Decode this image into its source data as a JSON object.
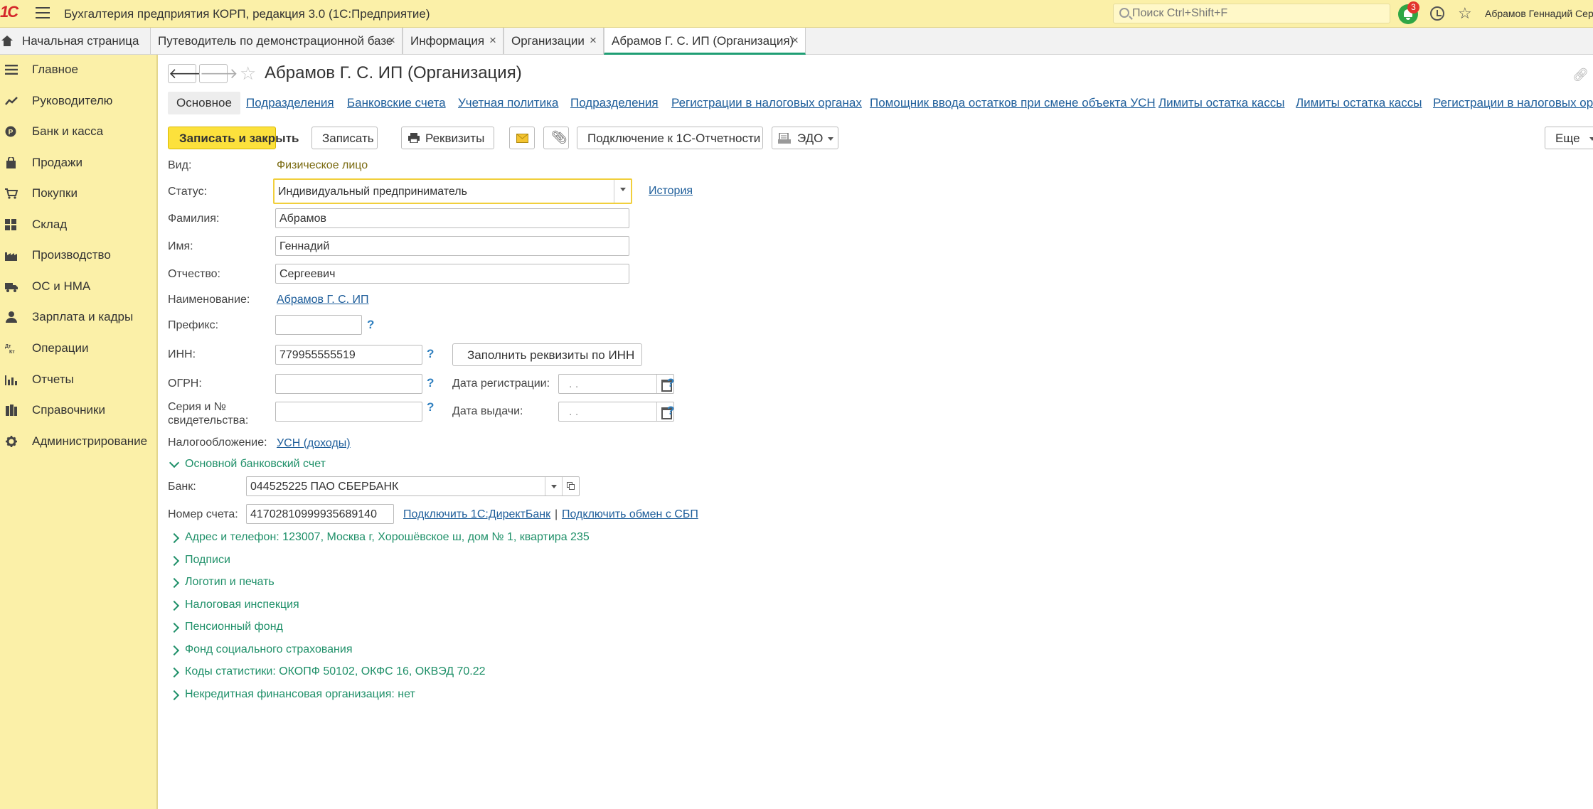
{
  "app": {
    "logo": "1С",
    "title": "Бухгалтерия предприятия КОРП, редакция 3.0  (1С:Предприятие)",
    "search_placeholder": "Поиск Ctrl+Shift+F",
    "notifications_count": "3",
    "user": "Абрамов Геннадий Серге"
  },
  "tabs": {
    "home": "Начальная страница",
    "items": [
      {
        "label": "Путеводитель по демонстрационной базе",
        "close": "×"
      },
      {
        "label": "Информация",
        "close": "×"
      },
      {
        "label": "Организации",
        "close": "×"
      },
      {
        "label": "Абрамов Г. С. ИП (Организация)",
        "close": "×"
      }
    ]
  },
  "sidebar": {
    "items": [
      {
        "label": "Главное",
        "icon": "menu-icon"
      },
      {
        "label": "Руководителю",
        "icon": "trend-icon"
      },
      {
        "label": "Банк и касса",
        "icon": "coin-icon"
      },
      {
        "label": "Продажи",
        "icon": "bag-icon"
      },
      {
        "label": "Покупки",
        "icon": "cart-icon"
      },
      {
        "label": "Склад",
        "icon": "grid-icon"
      },
      {
        "label": "Производство",
        "icon": "factory-icon"
      },
      {
        "label": "ОС и НМА",
        "icon": "truck-icon"
      },
      {
        "label": "Зарплата и кадры",
        "icon": "person-icon"
      },
      {
        "label": "Операции",
        "icon": "dt-kt-icon"
      },
      {
        "label": "Отчеты",
        "icon": "bar-chart-icon"
      },
      {
        "label": "Справочники",
        "icon": "books-icon"
      },
      {
        "label": "Администрирование",
        "icon": "gear-icon"
      }
    ]
  },
  "form": {
    "title": "Абрамов Г. С. ИП (Организация)",
    "nav": [
      "Основное",
      "Подразделения",
      "Банковские счета",
      "Учетная политика",
      "Подразделения",
      "Регистрации в налоговых органах",
      "Помощник ввода остатков при смене объекта УСН",
      "Лимиты остатка кассы",
      "Лимиты остатка кассы",
      "Регистрации в налоговых орга"
    ],
    "toolbar": {
      "save_close": "Записать и закрыть",
      "save": "Записать",
      "requisites": "Реквизиты",
      "connect_reporting": "Подключение к 1С-Отчетности",
      "edo": "ЭДО",
      "more": "Еще"
    },
    "fields": {
      "vid_label": "Вид:",
      "vid_value": "Физическое лицо",
      "status_label": "Статус:",
      "status_value": "Индивидуальный предприниматель",
      "history_link": "История",
      "surname_label": "Фамилия:",
      "surname_value": "Абрамов",
      "name_label": "Имя:",
      "name_value": "Геннадий",
      "patronymic_label": "Отчество:",
      "patronymic_value": "Сергеевич",
      "naim_label": "Наименование:",
      "naim_value": "Абрамов Г. С. ИП",
      "prefix_label": "Префикс:",
      "prefix_value": "",
      "inn_label": "ИНН:",
      "inn_value": "779955555519",
      "fill_by_inn": "Заполнить реквизиты по ИНН",
      "ogrn_label": "ОГРН:",
      "ogrn_value": "",
      "reg_date_label": "Дата регистрации:",
      "reg_date_value": ".  .",
      "cert_label_1": "Серия и №",
      "cert_label_2": "свидетельства:",
      "cert_value": "",
      "issue_date_label": "Дата выдачи:",
      "issue_date_value": ".  .",
      "tax_label": "Налогообложение:",
      "tax_value": "УСН (доходы)",
      "question": "?"
    },
    "bank": {
      "section": "Основной банковский счет",
      "bank_label": "Банк:",
      "bank_value": "044525225 ПАО СБЕРБАНК",
      "account_label": "Номер счета:",
      "account_value": "41702810999935689140",
      "direct_bank_link": "Подключить 1С:ДиректБанк",
      "separator": "|",
      "sbp_link": "Подключить обмен с СБП"
    },
    "sections": [
      "Адрес и телефон: 123007, Москва г, Хорошёвское ш, дом № 1, квартира 235",
      "Подписи",
      "Логотип и печать",
      "Налоговая инспекция",
      "Пенсионный фонд",
      "Фонд социального страхования",
      "Коды статистики: ОКОПФ 50102, ОКФС 16, ОКВЭД 70.22",
      "Некредитная финансовая организация: нет"
    ]
  }
}
